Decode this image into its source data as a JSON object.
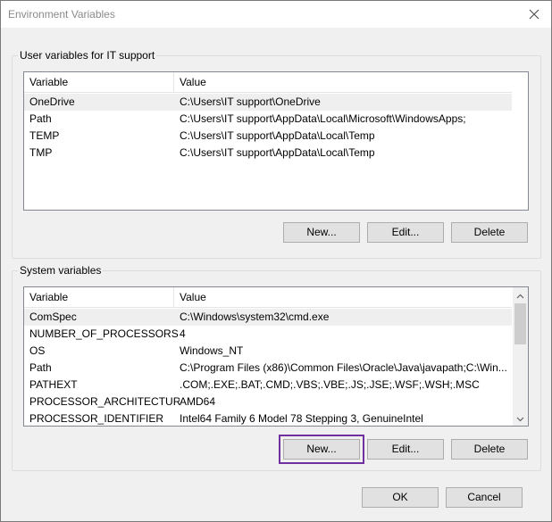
{
  "window": {
    "title": "Environment Variables"
  },
  "user_section": {
    "label": "User variables for IT support",
    "columns": [
      "Variable",
      "Value"
    ],
    "rows": [
      {
        "variable": "OneDrive",
        "value": "C:\\Users\\IT support\\OneDrive",
        "selected": true
      },
      {
        "variable": "Path",
        "value": "C:\\Users\\IT support\\AppData\\Local\\Microsoft\\WindowsApps;",
        "selected": false
      },
      {
        "variable": "TEMP",
        "value": "C:\\Users\\IT support\\AppData\\Local\\Temp",
        "selected": false
      },
      {
        "variable": "TMP",
        "value": "C:\\Users\\IT support\\AppData\\Local\\Temp",
        "selected": false
      }
    ],
    "buttons": {
      "new": "New...",
      "edit": "Edit...",
      "delete": "Delete"
    }
  },
  "system_section": {
    "label": "System variables",
    "columns": [
      "Variable",
      "Value"
    ],
    "rows": [
      {
        "variable": "ComSpec",
        "value": "C:\\Windows\\system32\\cmd.exe",
        "selected": true
      },
      {
        "variable": "NUMBER_OF_PROCESSORS",
        "value": "4",
        "selected": false
      },
      {
        "variable": "OS",
        "value": "Windows_NT",
        "selected": false
      },
      {
        "variable": "Path",
        "value": "C:\\Program Files (x86)\\Common Files\\Oracle\\Java\\javapath;C:\\Win...",
        "selected": false
      },
      {
        "variable": "PATHEXT",
        "value": ".COM;.EXE;.BAT;.CMD;.VBS;.VBE;.JS;.JSE;.WSF;.WSH;.MSC",
        "selected": false
      },
      {
        "variable": "PROCESSOR_ARCHITECTURE",
        "value": "AMD64",
        "selected": false
      },
      {
        "variable": "PROCESSOR_IDENTIFIER",
        "value": "Intel64 Family 6 Model 78 Stepping 3, GenuineIntel",
        "selected": false
      }
    ],
    "buttons": {
      "new": "New...",
      "edit": "Edit...",
      "delete": "Delete"
    },
    "highlight_color": "#7030a0"
  },
  "footer": {
    "ok": "OK",
    "cancel": "Cancel"
  },
  "icons": {
    "close": "close-icon",
    "scroll_up": "chevron-up-icon",
    "scroll_down": "chevron-down-icon"
  }
}
